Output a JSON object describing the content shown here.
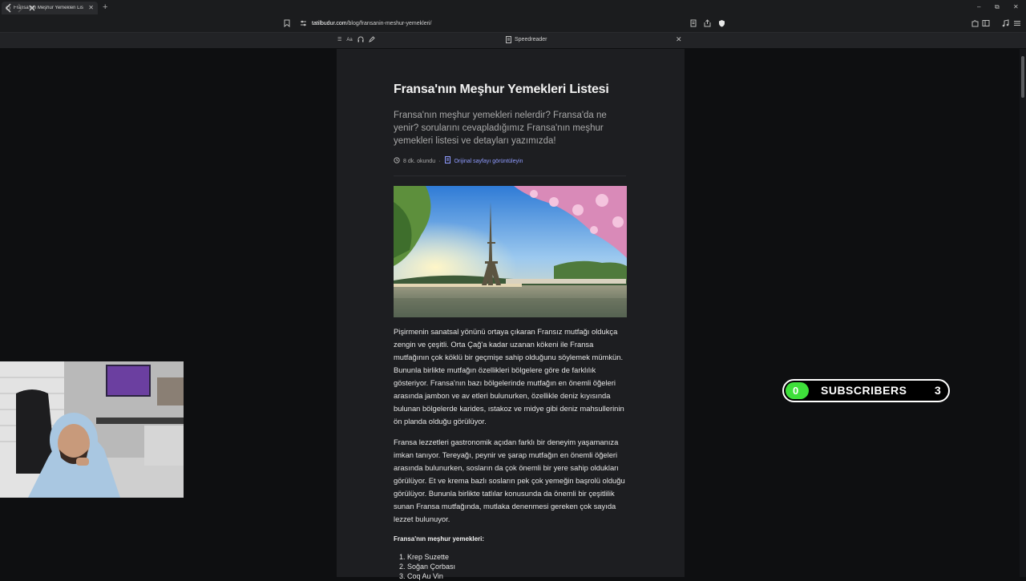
{
  "browser": {
    "tab_title": "Fransa'nın Meşhur Yemekleri Lis",
    "new_tab": "+",
    "url_domain": "tatilbudur.com",
    "url_path": "/blog/fransanin-meshur-yemekleri/",
    "window_controls": {
      "minimize": "–",
      "restore": "⧉",
      "close": "✕"
    }
  },
  "reader": {
    "title": "Speedreader",
    "tools": [
      "☰",
      "Aa",
      "🎧",
      "✎"
    ],
    "close": "✕"
  },
  "article": {
    "title": "Fransa'nın Meşhur Yemekleri Listesi",
    "lead": "Fransa'nın meşhur yemekleri nelerdir? Fransa'da ne yenir? sorularını cevapladığımız Fransa'nın meşhur yemekleri listesi ve detayları yazımızda!",
    "read_time": "8 dk. okundu",
    "separator": "·",
    "original_link": "Orijinal sayfayı görüntüleyin",
    "paragraph1": "Pişirmenin sanatsal yönünü ortaya çıkaran Fransız mutfağı oldukça zengin ve çeşitli. Orta Çağ'a kadar uzanan kökeni ile Fransa mutfağının çok köklü bir geçmişe sahip olduğunu söylemek mümkün. Bununla birlikte mutfağın özellikleri bölgelere göre de farklılık gösteriyor. Fransa'nın bazı bölgelerinde mutfağın en önemli öğeleri arasında jambon ve av etleri bulunurken, özellikle deniz kıyısında bulunan bölgelerde karides, ıstakoz ve midye gibi deniz mahsullerinin ön planda olduğu görülüyor.",
    "paragraph2": "Fransa lezzetleri gastronomik açıdan farklı bir deneyim yaşamanıza imkan tanıyor. Tereyağı, peynir ve şarap mutfağın en önemli öğeleri arasında bulunurken, sosların da çok önemli bir yere sahip oldukları görülüyor. Et ve krema bazlı sosların pek çok yemeğin başrolü olduğu görülüyor. Bununla birlikte tatlılar konusunda da önemli bir çeşitlilik sunan Fransa mutfağında, mutlaka denenmesi gereken çok sayıda lezzet bulunuyor.",
    "list_heading": "Fransa'nın meşhur yemekleri:",
    "list": [
      "1. Krep Suzette",
      "2. Soğan Çorbası",
      "3. Coq Au Vin"
    ]
  },
  "subscribers": {
    "badge": "0",
    "label": "SUBSCRIBERS",
    "count": "3"
  },
  "colors": {
    "accent_link": "#8f9bff",
    "badge_green": "#3ee03a",
    "page_bg": "#0e0f11",
    "article_bg": "#1d1e21"
  }
}
